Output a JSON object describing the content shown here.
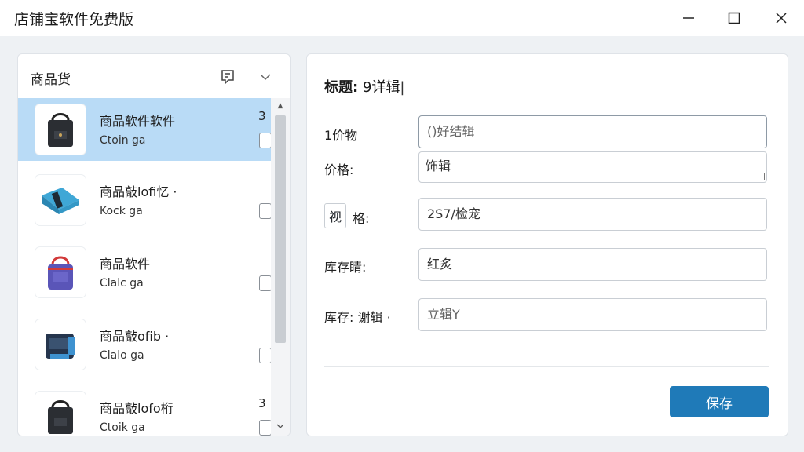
{
  "window": {
    "title": "店铺宝软件免费版",
    "minimize_glyph": "—",
    "maximize_glyph": "☐",
    "close_glyph": "✕"
  },
  "left_panel": {
    "title": "商品货",
    "icons": [
      "note-icon",
      "chevron-down-icon"
    ],
    "items": [
      {
        "name": "商品软件软件",
        "sub": "Ctoin ga",
        "qty": "3",
        "selected": true,
        "bag": "black"
      },
      {
        "name": "商品敲lofi忆 ·",
        "sub": "Kock ga",
        "qty": "",
        "selected": false,
        "bag": "blue"
      },
      {
        "name": "商品软件",
        "sub": "Clalc ga",
        "qty": "",
        "selected": false,
        "bag": "purple"
      },
      {
        "name": "商品敲ofib ·",
        "sub": "Clalo ga",
        "qty": "",
        "selected": false,
        "bag": "navy"
      },
      {
        "name": "商品敲lofo桁",
        "sub": "Ctoik ga",
        "qty": "3",
        "selected": false,
        "bag": "black"
      }
    ]
  },
  "form": {
    "title_label": "标题:",
    "title_value": "9详辑",
    "fields": [
      {
        "label": "1价物",
        "value": "()好结辑"
      },
      {
        "label": "价格:",
        "value": "饰辑"
      },
      {
        "label": "格:",
        "prefix": "视",
        "value": "2S7/检宠"
      },
      {
        "label": "库存睛:",
        "value": "红炙"
      },
      {
        "label": "库存: 谢辑 ·",
        "value": "立辑Y"
      }
    ],
    "save_label": "保存"
  },
  "colors": {
    "selected_row": "#b9dbf6",
    "save_button": "#1f7ab8"
  }
}
